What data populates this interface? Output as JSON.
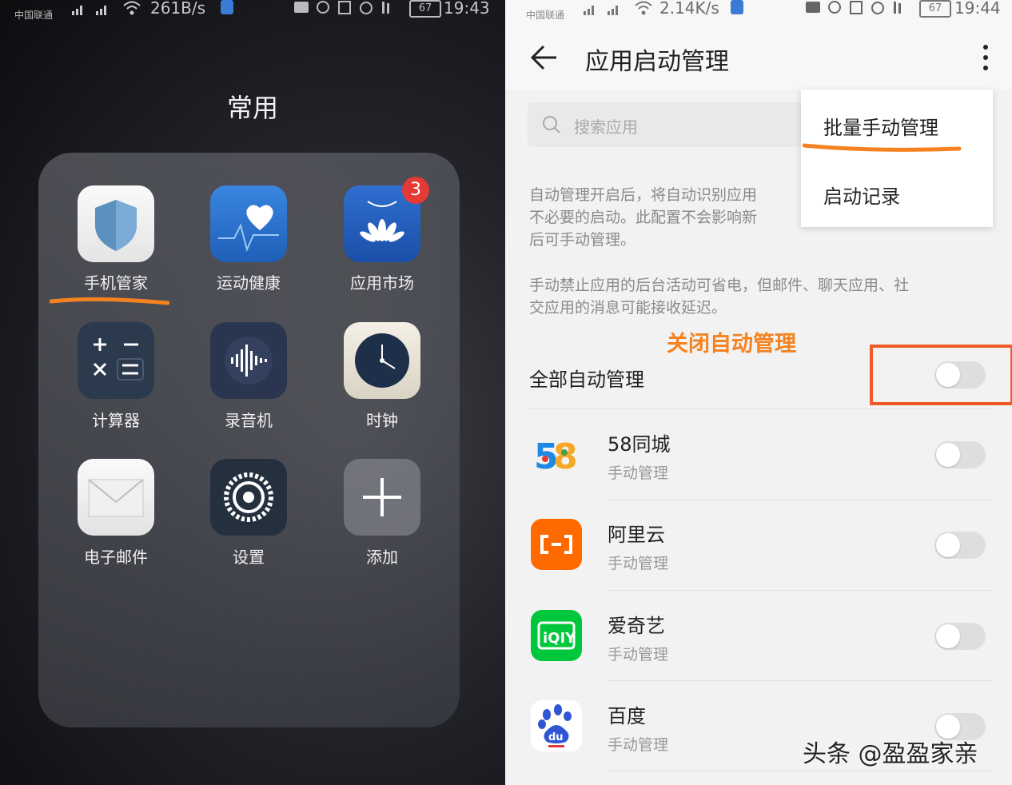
{
  "left": {
    "status": {
      "carrier": "中国联通",
      "speed": "261B/s",
      "time": "19:43",
      "battery": "67"
    },
    "folder_title": "常用",
    "apps": [
      {
        "label": "手机管家",
        "icon": "shield-icon"
      },
      {
        "label": "运动健康",
        "icon": "heart-icon"
      },
      {
        "label": "应用市场",
        "icon": "huawei-bag-icon",
        "badge": "3"
      },
      {
        "label": "计算器",
        "icon": "calculator-icon"
      },
      {
        "label": "录音机",
        "icon": "waveform-icon"
      },
      {
        "label": "时钟",
        "icon": "clock-icon"
      },
      {
        "label": "电子邮件",
        "icon": "envelope-icon"
      },
      {
        "label": "设置",
        "icon": "gear-icon"
      },
      {
        "label": "添加",
        "icon": "plus-icon"
      }
    ],
    "highlight_color": "#f5821f"
  },
  "right": {
    "status": {
      "carrier": "中国联通",
      "speed": "2.14K/s",
      "time": "19:44",
      "battery": "67"
    },
    "title": "应用启动管理",
    "search_placeholder": "搜索应用",
    "menu": [
      "批量手动管理",
      "启动记录"
    ],
    "desc1": [
      "自动管理开启后，将自动识别应用",
      "不必要的启动。此配置不会影响新",
      "后可手动管理。"
    ],
    "desc2": [
      "手动禁止应用的后台活动可省电，但邮件、聊天应用、社",
      "交应用的消息可能接收延迟。"
    ],
    "annotation": "关闭自动管理",
    "master_label": "全部自动管理",
    "apps": [
      {
        "name": "58同城",
        "status": "手动管理"
      },
      {
        "name": "阿里云",
        "status": "手动管理"
      },
      {
        "name": "爱奇艺",
        "status": "手动管理"
      },
      {
        "name": "百度",
        "status": "手动管理"
      }
    ],
    "watermark": "头条 @盈盈家亲",
    "accent_orange": "#f5821f"
  }
}
